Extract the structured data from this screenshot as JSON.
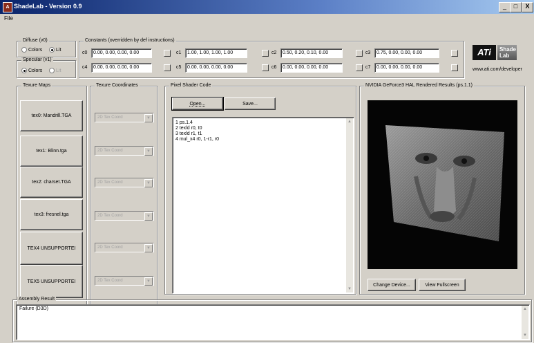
{
  "window": {
    "title": "ShadeLab - Version 0.9",
    "app_icon": "ati-icon",
    "minimize": "_",
    "maximize": "□",
    "close": "X"
  },
  "menu": {
    "file": "File"
  },
  "diffuse": {
    "group_label": "Diffuse (v0)",
    "options": [
      "Colors",
      "Lit"
    ],
    "selected": "Lit"
  },
  "specular": {
    "group_label": "Specular (v1)",
    "options": [
      "Colors",
      "Lit"
    ],
    "selected": "Colors"
  },
  "constants": {
    "group_label": "Constants (overridden by def instructions)",
    "items": [
      {
        "label": "c0",
        "value": "0.00, 0.00, 0.00, 0.00"
      },
      {
        "label": "c1",
        "value": "1.00, 1.00, 1.00, 1.00"
      },
      {
        "label": "c2",
        "value": "0.50, 0.20, 0.10, 0.00"
      },
      {
        "label": "c3",
        "value": "0.75, 0.00, 0.00, 0.00"
      },
      {
        "label": "c4",
        "value": "0.00, 0.00, 0.00, 0.00"
      },
      {
        "label": "c5",
        "value": "0.00, 0.00, 0.00, 0.00"
      },
      {
        "label": "c6",
        "value": "0.00, 0.00, 0.00, 0.00"
      },
      {
        "label": "c7",
        "value": "0.00, 0.00, 0.00, 0.00"
      }
    ]
  },
  "logo": {
    "ati": "ATi",
    "shade": "Shade",
    "lab": "Lab",
    "url": "www.ati.com/developer"
  },
  "texture_maps": {
    "group_label": "Texure Maps",
    "items": [
      "tex0: Mandrill.TGA",
      "tex1: Blinn.tga",
      "tex2: charset.TGA",
      "tex3: fresnel.tga",
      "TEX4 UNSUPPORTEI",
      "TEX5 UNSUPPORTEI"
    ]
  },
  "texture_coords": {
    "group_label": "Texure Coordinates",
    "items": [
      "2D Tex Coord",
      "2D Tex Coord",
      "2D Tex Coord",
      "2D Tex Coord",
      "2D Tex Coord",
      "2D Tex Coord"
    ]
  },
  "shader": {
    "group_label": "Pixel Shader Code",
    "open": "Open...",
    "save": "Save...",
    "lines": [
      "1  ps.1.4",
      "2  texld r0, t0",
      "3  texld r1, t1",
      "4  mul_x4 r0, 1-r1, r0"
    ]
  },
  "render": {
    "group_label": "NVIDIA GeForce3 HAL Rendered Results (ps.1.1)",
    "change_device": "Change Device...",
    "view_fullscreen": "View Fullscreen"
  },
  "assembly": {
    "group_label": "Assembly Result",
    "text": "Failure (D3D)"
  },
  "colors": {
    "titlebar_start": "#0a246a",
    "titlebar_end": "#a6caf0",
    "face": "#d4d0c8"
  }
}
